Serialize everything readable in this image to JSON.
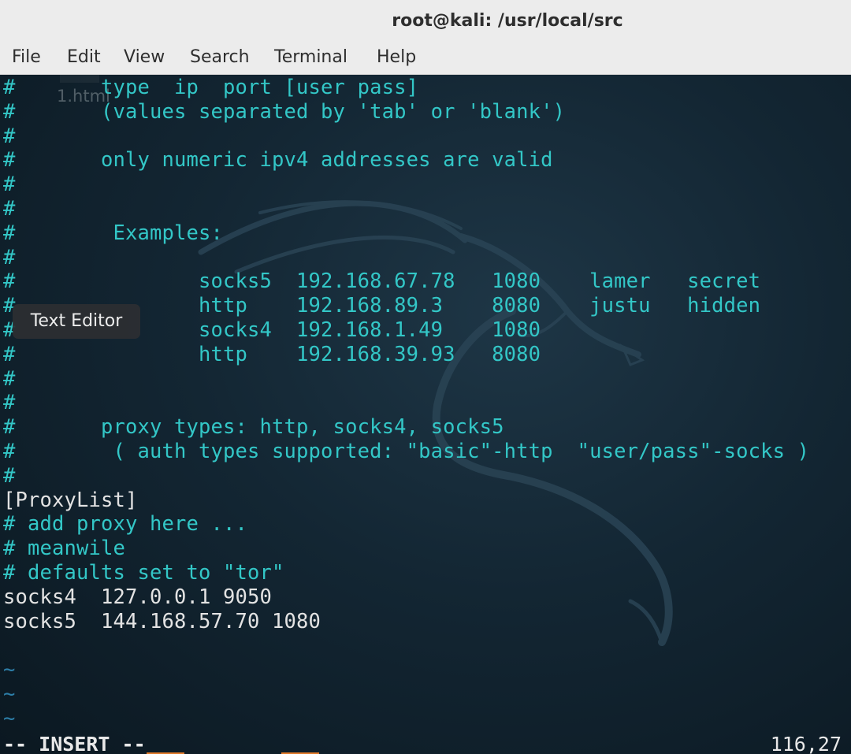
{
  "window": {
    "title": "root@kali: /usr/local/src"
  },
  "menu": [
    "File",
    "Edit",
    "View",
    "Search",
    "Terminal",
    "Help"
  ],
  "ghost_tab_label": "1.html",
  "tooltip": "Text Editor",
  "lines": [
    {
      "text": "#       type  ip  port [user pass]",
      "style": "comment"
    },
    {
      "text": "#       (values separated by 'tab' or 'blank')",
      "style": "comment"
    },
    {
      "text": "#",
      "style": "comment"
    },
    {
      "text": "#       only numeric ipv4 addresses are valid",
      "style": "comment"
    },
    {
      "text": "#",
      "style": "comment"
    },
    {
      "text": "#",
      "style": "comment"
    },
    {
      "text": "#        Examples:",
      "style": "comment"
    },
    {
      "text": "#",
      "style": "comment"
    },
    {
      "text": "#               socks5  192.168.67.78   1080    lamer   secret",
      "style": "comment"
    },
    {
      "text": "#               http    192.168.89.3    8080    justu   hidden",
      "style": "comment"
    },
    {
      "text": "#               socks4  192.168.1.49    1080",
      "style": "comment"
    },
    {
      "text": "#               http    192.168.39.93   8080",
      "style": "comment"
    },
    {
      "text": "#",
      "style": "comment"
    },
    {
      "text": "#",
      "style": "comment"
    },
    {
      "text": "#       proxy types: http, socks4, socks5",
      "style": "comment"
    },
    {
      "text": "#        ( auth types supported: \"basic\"-http  \"user/pass\"-socks )",
      "style": "comment"
    },
    {
      "text": "#",
      "style": "comment"
    },
    {
      "text": "[ProxyList]",
      "style": "plain"
    },
    {
      "text": "# add proxy here ...",
      "style": "comment"
    },
    {
      "text": "# meanwile",
      "style": "comment"
    },
    {
      "text": "# defaults set to \"tor\"",
      "style": "comment"
    },
    {
      "text": "socks4  127.0.0.1 9050",
      "style": "plain"
    },
    {
      "text": "socks5  144.168.57.70 1080",
      "style": "plain"
    },
    {
      "text": "",
      "style": "plain"
    },
    {
      "text": "~",
      "style": "tilde"
    },
    {
      "text": "~",
      "style": "tilde"
    },
    {
      "text": "~",
      "style": "tilde"
    }
  ],
  "status": {
    "mode": "-- INSERT --",
    "position": "116,27"
  },
  "colors": {
    "comment": "#33c7c7",
    "plain": "#e3e3e3",
    "tilde": "#2d7ea8",
    "background": "#132633"
  }
}
